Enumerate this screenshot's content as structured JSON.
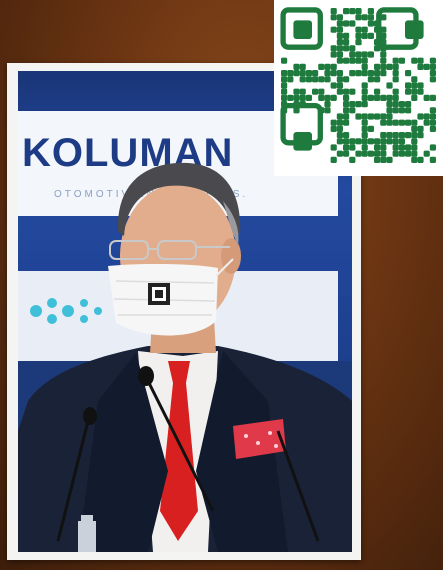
{
  "photo": {
    "banner_brand": "KOLUMAN",
    "banner_subtext": "OTOMOTIV ENDUSTRI A.S."
  },
  "qr": {
    "color": "#1f7a3e"
  }
}
